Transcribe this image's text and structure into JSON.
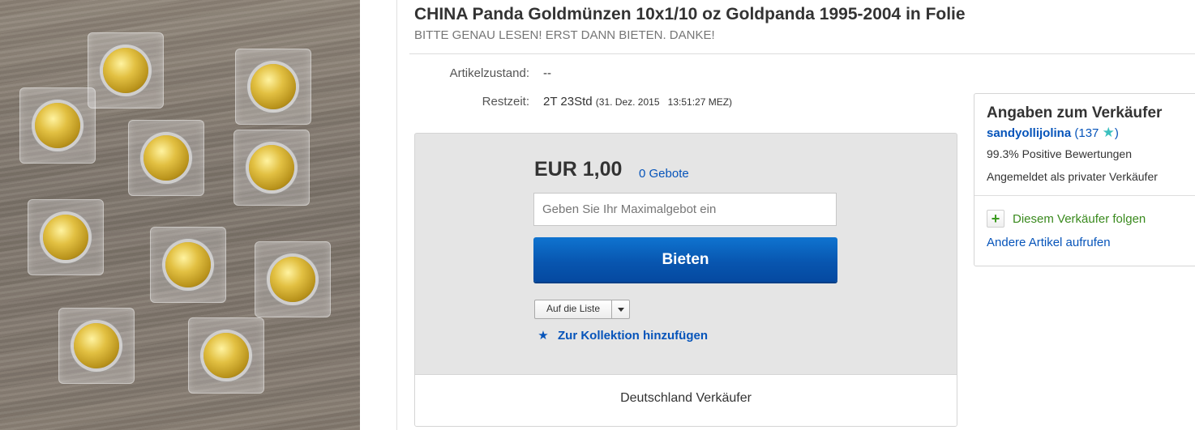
{
  "listing": {
    "title": "CHINA Panda Goldmünzen 10x1/10 oz Goldpanda 1995-2004 in Folie",
    "subtitle": "BITTE GENAU LESEN! ERST DANN BIETEN. DANKE!",
    "image_alt": "Goldmünzen in Folie",
    "coin_count": 10
  },
  "details": {
    "condition_label": "Artikelzustand:",
    "condition_value": "--",
    "time_label": "Restzeit:",
    "time_remaining": "2T 23Std",
    "end_date": "(31. Dez. 2015",
    "end_time": "13:51:27 MEZ)"
  },
  "bid": {
    "price": "EUR 1,00",
    "bids_count": "0 Gebote",
    "input_placeholder": "Geben Sie Ihr Maximalgebot ein",
    "input_value": "",
    "button_label": "Bieten",
    "watch_label": "Auf die Liste",
    "collection_icon": "star-icon",
    "collection_label": "Zur Kollektion hinzufügen",
    "footer_text": "Deutschland Verkäufer"
  },
  "seller": {
    "heading": "Angaben zum Verkäufer",
    "name": "sandyollijolina",
    "score_open": "(",
    "score": "137",
    "score_close": ")",
    "star_icon": "teal-star-icon",
    "positive": "99.3% Positive Bewertungen",
    "type": "Angemeldet als privater Verkäufer",
    "follow_label": "Diesem Verkäufer folgen",
    "follow_icon": "plus-icon",
    "other_items_label": "Andere Artikel aufrufen"
  },
  "colors": {
    "link": "#0654ba",
    "bid_button": "#0856b0",
    "follow": "#3a8a1e",
    "star_teal": "#3cc0bf",
    "panel_bg": "#e5e5e5"
  }
}
